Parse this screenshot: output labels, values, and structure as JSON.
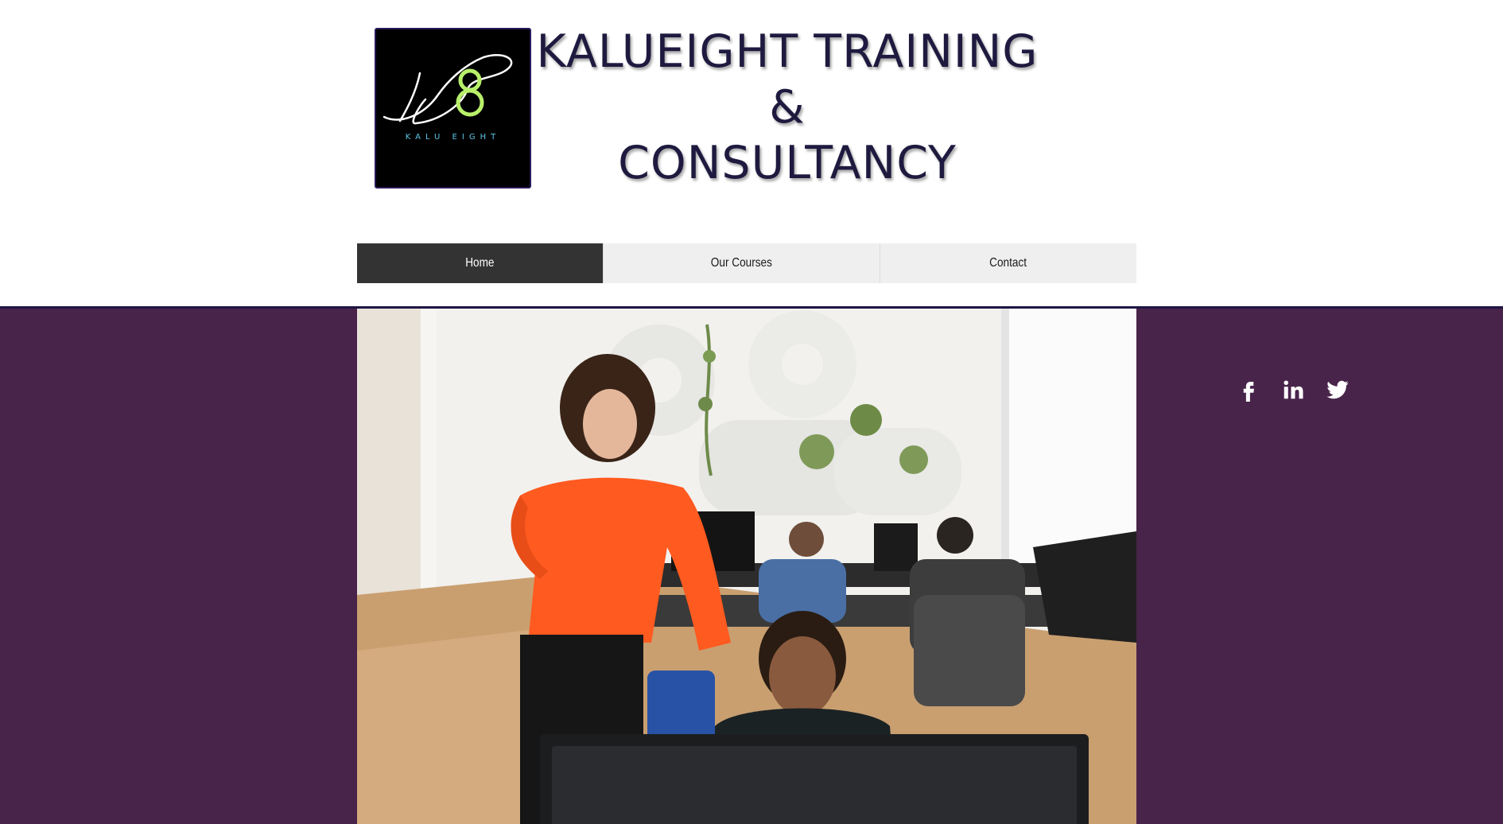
{
  "logo": {
    "monogram": "K8",
    "caption": "KALU EIGHT"
  },
  "title": {
    "line1": "KALUEIGHT TRAINING",
    "line2": "&",
    "line3": "CONSULTANCY"
  },
  "nav": {
    "items": [
      {
        "label": "Home",
        "active": true
      },
      {
        "label": "Our Courses",
        "active": false
      },
      {
        "label": "Contact",
        "active": false
      }
    ]
  },
  "social": {
    "icons": [
      "facebook-icon",
      "linkedin-icon",
      "twitter-icon"
    ]
  },
  "colors": {
    "band": "#48244a",
    "title": "#1e1a3f",
    "nav_active": "#333333",
    "nav_bg": "#efefef",
    "logo_green": "#b8f06a"
  }
}
